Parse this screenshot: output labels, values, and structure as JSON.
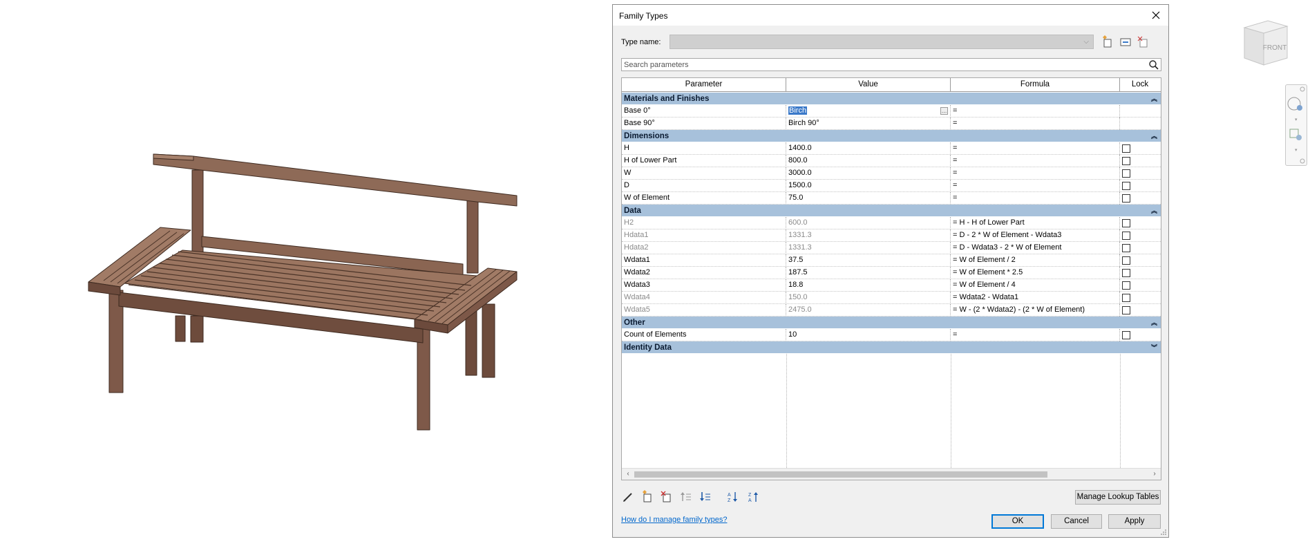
{
  "dialog": {
    "title": "Family Types",
    "type_name_label": "Type name:",
    "type_name_value": "",
    "search_placeholder": "Search parameters"
  },
  "columns": [
    "Parameter",
    "Value",
    "Formula",
    "Lock"
  ],
  "groups": [
    {
      "name": "Materials and Finishes",
      "collapsed": false,
      "rows": [
        {
          "param": "Base 0°",
          "value": "Birch",
          "formula": "=",
          "lock": null,
          "selected": true,
          "gray": false
        },
        {
          "param": "Base 90°",
          "value": "Birch 90°",
          "formula": "=",
          "lock": null,
          "gray": false
        }
      ]
    },
    {
      "name": "Dimensions",
      "collapsed": false,
      "rows": [
        {
          "param": "H",
          "value": "1400.0",
          "formula": "=",
          "lock": false,
          "gray": false
        },
        {
          "param": "H of Lower Part",
          "value": "800.0",
          "formula": "=",
          "lock": false,
          "gray": false
        },
        {
          "param": "W",
          "value": "3000.0",
          "formula": "=",
          "lock": false,
          "gray": false
        },
        {
          "param": "D",
          "value": "1500.0",
          "formula": "=",
          "lock": false,
          "gray": false
        },
        {
          "param": "W of Element",
          "value": "75.0",
          "formula": "=",
          "lock": false,
          "gray": false
        }
      ]
    },
    {
      "name": "Data",
      "collapsed": false,
      "rows": [
        {
          "param": "H2",
          "value": "600.0",
          "formula": "= H - H of Lower Part",
          "lock": false,
          "gray": true
        },
        {
          "param": "Hdata1",
          "value": "1331.3",
          "formula": "= D - 2 * W of Element - Wdata3",
          "lock": false,
          "gray": true
        },
        {
          "param": "Hdata2",
          "value": "1331.3",
          "formula": "= D - Wdata3 - 2 * W of Element",
          "lock": false,
          "gray": true
        },
        {
          "param": "Wdata1",
          "value": "37.5",
          "formula": "= W of Element / 2",
          "lock": false,
          "gray": false
        },
        {
          "param": "Wdata2",
          "value": "187.5",
          "formula": "= W of Element * 2.5",
          "lock": false,
          "gray": false
        },
        {
          "param": "Wdata3",
          "value": "18.8",
          "formula": "= W of Element / 4",
          "lock": false,
          "gray": false
        },
        {
          "param": "Wdata4",
          "value": "150.0",
          "formula": "= Wdata2 - Wdata1",
          "lock": false,
          "gray": true
        },
        {
          "param": "Wdata5",
          "value": "2475.0",
          "formula": "= W - (2 * Wdata2) - (2 * W of Element)",
          "lock": false,
          "gray": true
        }
      ]
    },
    {
      "name": "Other",
      "collapsed": false,
      "rows": [
        {
          "param": "Count of Elements",
          "value": "10",
          "formula": "=",
          "lock": false,
          "gray": false
        }
      ]
    },
    {
      "name": "Identity Data",
      "collapsed": true,
      "rows": []
    }
  ],
  "buttons": {
    "manage_lookup": "Manage Lookup Tables",
    "ok": "OK",
    "cancel": "Cancel",
    "apply": "Apply"
  },
  "help_link": "How do I manage family types?",
  "viewcube_label": "FRONT",
  "colors": {
    "group_header": "#a7c1db",
    "selection": "#3a79c9",
    "wood": "#8a6552"
  }
}
